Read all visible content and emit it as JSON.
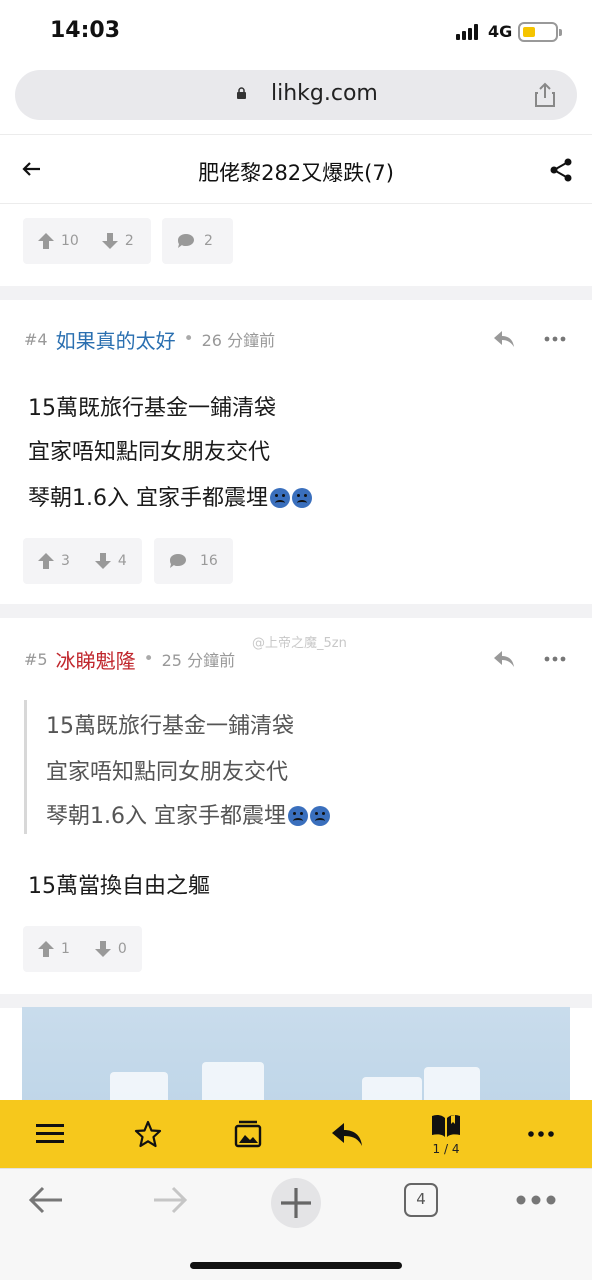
{
  "status": {
    "time": "14:03",
    "network": "4G"
  },
  "browser": {
    "url": "lihkg.com"
  },
  "thread": {
    "title": "肥佬黎282又爆跌(7)"
  },
  "prev_post_votes": {
    "up": "10",
    "down": "2",
    "comments": "2"
  },
  "posts": [
    {
      "num": "#4",
      "author": "如果真的太好",
      "time": "26 分鐘前",
      "lines": [
        "15萬既旅行基金一鋪清袋",
        "宜家唔知點同女朋友交代",
        "琴朝1.6入 宜家手都震埋"
      ],
      "votes": {
        "up": "3",
        "down": "4",
        "comments": "16"
      }
    },
    {
      "num": "#5",
      "author": "冰睇魁隆",
      "time": "25 分鐘前",
      "quote": [
        "15萬既旅行基金一鋪清袋",
        "宜家唔知點同女朋友交代",
        "琴朝1.6入 宜家手都震埋"
      ],
      "lines": [
        "15萬當換自由之軀"
      ],
      "votes": {
        "up": "1",
        "down": "0"
      }
    }
  ],
  "watermark": "@上帝之魔_5zn",
  "toolbar": {
    "page_indicator": "1 / 4"
  },
  "browser_nav": {
    "tab_count": "4"
  },
  "colors": {
    "toolbar": "#f6c81c",
    "author_blue": "#2a6fb0",
    "author_red": "#c0272d"
  },
  "icons": [
    "lock-icon",
    "share-upload-icon",
    "back-arrow-icon",
    "share-icon",
    "thumb-up-icon",
    "thumb-down-icon",
    "comment-icon",
    "reply-icon",
    "more-icon",
    "menu-icon",
    "star-icon",
    "image-icon",
    "reply-arrow-icon",
    "book-icon",
    "ellipsis-icon",
    "nav-back-icon",
    "nav-forward-icon",
    "new-tab-icon",
    "tab-count-icon",
    "browser-more-icon"
  ]
}
